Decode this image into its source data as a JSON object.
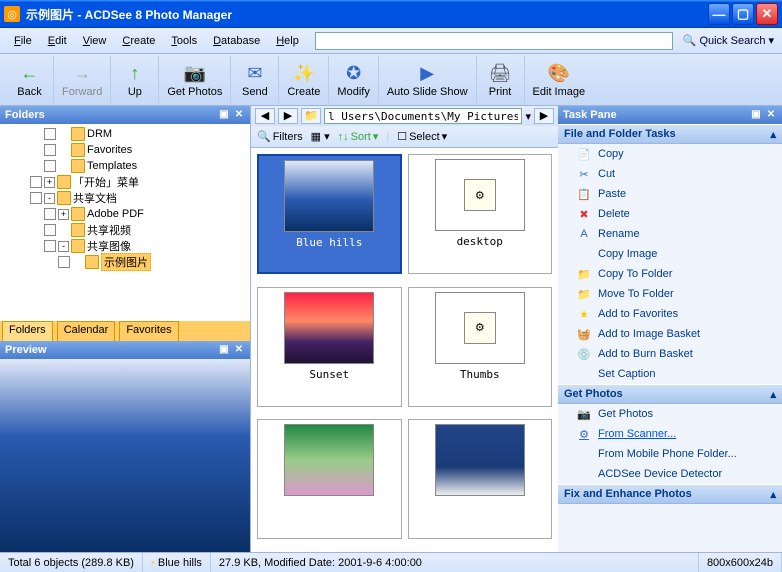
{
  "window": {
    "title": "示例图片 - ACDSee 8 Photo Manager"
  },
  "menu": [
    "File",
    "Edit",
    "View",
    "Create",
    "Tools",
    "Database",
    "Help"
  ],
  "quicksearch": {
    "label": "Quick Search"
  },
  "toolbar": [
    {
      "label": "Back",
      "icon": "←",
      "color": "#3a3"
    },
    {
      "label": "Forward",
      "icon": "→",
      "color": "#aaa",
      "dis": true
    },
    {
      "label": "Up",
      "icon": "↑",
      "color": "#3a3"
    },
    {
      "label": "Get Photos",
      "icon": "📷",
      "color": "#f90"
    },
    {
      "label": "Send",
      "icon": "✉",
      "color": "#36c"
    },
    {
      "label": "Create",
      "icon": "✨",
      "color": "#f90"
    },
    {
      "label": "Modify",
      "icon": "✪",
      "color": "#36c"
    },
    {
      "label": "Auto Slide Show",
      "icon": "▶",
      "color": "#36c"
    },
    {
      "label": "Print",
      "icon": "🖨",
      "color": "#555"
    },
    {
      "label": "Edit Image",
      "icon": "🎨",
      "color": "#c33"
    }
  ],
  "folders": {
    "title": "Folders"
  },
  "tree": [
    {
      "ind": 3,
      "tw": "",
      "label": "DRM"
    },
    {
      "ind": 3,
      "tw": "",
      "label": "Favorites"
    },
    {
      "ind": 3,
      "tw": "",
      "label": "Templates"
    },
    {
      "ind": 2,
      "tw": "+",
      "label": "「开始」菜单"
    },
    {
      "ind": 2,
      "tw": "-",
      "label": "共享文档"
    },
    {
      "ind": 3,
      "tw": "+",
      "label": "Adobe PDF"
    },
    {
      "ind": 3,
      "tw": "",
      "label": "共享视频"
    },
    {
      "ind": 3,
      "tw": "-",
      "label": "共享图像"
    },
    {
      "ind": 4,
      "tw": "",
      "label": "示例图片",
      "sel": true
    }
  ],
  "tabs": [
    "Folders",
    "Calendar",
    "Favorites"
  ],
  "preview": {
    "title": "Preview"
  },
  "path": {
    "value": "l Users\\Documents\\My Pictures\\示例图片"
  },
  "filterbar": {
    "filters": "Filters",
    "sort": "Sort",
    "select": "Select"
  },
  "thumbnails": [
    {
      "name": "Blue hills",
      "sel": true,
      "kind": "bluehills"
    },
    {
      "name": "desktop",
      "kind": "ini"
    },
    {
      "name": "Sunset",
      "kind": "sunset"
    },
    {
      "name": "Thumbs",
      "kind": "db"
    },
    {
      "name": "",
      "kind": "lilies"
    },
    {
      "name": "",
      "kind": "winter"
    }
  ],
  "taskpane": {
    "title": "Task Pane"
  },
  "sections": [
    {
      "title": "File and Folder Tasks",
      "items": [
        {
          "icon": "📄",
          "label": "Copy"
        },
        {
          "icon": "✂",
          "label": "Cut"
        },
        {
          "icon": "📋",
          "label": "Paste"
        },
        {
          "icon": "✖",
          "label": "Delete",
          "color": "#d33"
        },
        {
          "icon": "A",
          "label": "Rename"
        },
        {
          "icon": "",
          "label": "Copy Image"
        },
        {
          "icon": "📁",
          "label": "Copy To Folder",
          "color": "#3a3"
        },
        {
          "icon": "📁",
          "label": "Move To Folder",
          "color": "#36c"
        },
        {
          "icon": "★",
          "label": "Add to Favorites",
          "color": "#fc0"
        },
        {
          "icon": "🧺",
          "label": "Add to Image Basket",
          "color": "#36c"
        },
        {
          "icon": "💿",
          "label": "Add to Burn Basket",
          "color": "#f90"
        },
        {
          "icon": "",
          "label": "Set Caption"
        }
      ]
    },
    {
      "title": "Get Photos",
      "items": [
        {
          "icon": "📷",
          "label": "Get Photos"
        },
        {
          "icon": "⚙",
          "label": "From Scanner...",
          "link": true
        },
        {
          "icon": "",
          "label": "From Mobile Phone Folder..."
        },
        {
          "icon": "",
          "label": "ACDSee Device Detector"
        }
      ]
    },
    {
      "title": "Fix and Enhance Photos",
      "items": []
    }
  ],
  "status": {
    "count": "Total 6 objects  (289.8 KB)",
    "sel": "Blue hills",
    "info": "27.9 KB, Modified Date: 2001-9-6 4:00:00",
    "dim": "800x600x24b"
  }
}
